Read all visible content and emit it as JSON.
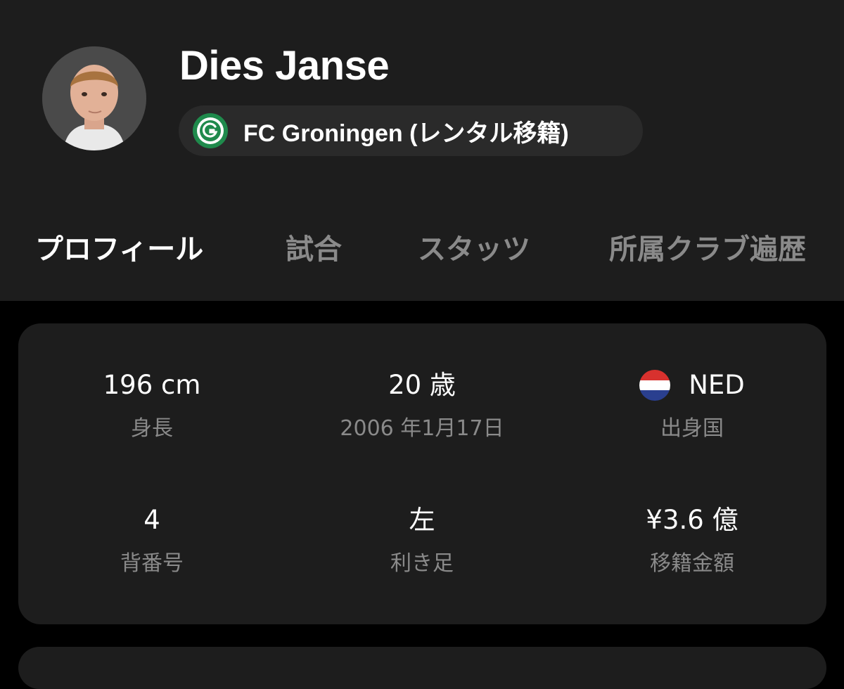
{
  "player": {
    "name": "Dies Janse",
    "club": "FC Groningen (レンタル移籍)"
  },
  "tabs": [
    {
      "label": "プロフィール",
      "active": true
    },
    {
      "label": "試合",
      "active": false
    },
    {
      "label": "スタッツ",
      "active": false
    },
    {
      "label": "所属クラブ遍歴",
      "active": false
    }
  ],
  "stats": {
    "height": {
      "value": "196 cm",
      "label": "身長"
    },
    "age": {
      "value": "20 歳",
      "label": "2006 年1月17日"
    },
    "country": {
      "value": "NED",
      "label": "出身国"
    },
    "shirt": {
      "value": "4",
      "label": "背番号"
    },
    "foot": {
      "value": "左",
      "label": "利き足"
    },
    "transfer": {
      "value": "¥3.6 億",
      "label": "移籍金額"
    }
  },
  "icons": {
    "avatar": "player-avatar",
    "club": "fc-groningen-logo",
    "flag": "netherlands-flag"
  },
  "colors": {
    "background": "#000000",
    "panel": "#1d1d1d",
    "pill": "#2a2a2a",
    "muted_text": "#8a8a8a",
    "club_green": "#1f8a4c",
    "flag_red": "#d8312e",
    "flag_blue": "#2a3f8f"
  }
}
